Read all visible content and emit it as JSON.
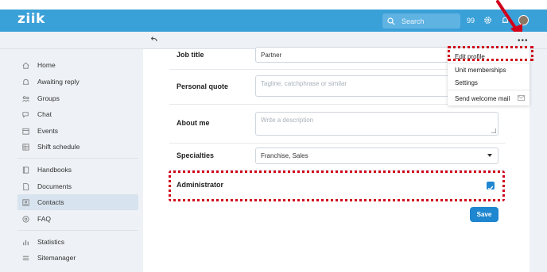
{
  "app": {
    "logo": "ziik"
  },
  "header": {
    "search_placeholder": "Search",
    "count": "99",
    "icons": [
      "search-icon",
      "gear-icon",
      "bell-icon",
      "avatar"
    ]
  },
  "sidebar": {
    "items": [
      {
        "label": "Home",
        "icon": "home-icon"
      },
      {
        "label": "Awaiting reply",
        "icon": "bell-icon"
      },
      {
        "label": "Groups",
        "icon": "groups-icon"
      },
      {
        "label": "Chat",
        "icon": "chat-icon"
      },
      {
        "label": "Events",
        "icon": "calendar-icon"
      },
      {
        "label": "Shift schedule",
        "icon": "schedule-icon"
      },
      {
        "label": "Handbooks",
        "icon": "book-icon"
      },
      {
        "label": "Documents",
        "icon": "document-icon"
      },
      {
        "label": "Contacts",
        "icon": "contacts-icon",
        "active": true
      },
      {
        "label": "FAQ",
        "icon": "faq-icon"
      },
      {
        "label": "Statistics",
        "icon": "statistics-icon"
      },
      {
        "label": "Sitemanager",
        "icon": "sitemanager-icon"
      }
    ]
  },
  "form": {
    "job_title": {
      "label": "Job title",
      "value": "Partner"
    },
    "personal_quote": {
      "label": "Personal quote",
      "placeholder": "Tagline, catchphrase or similar"
    },
    "about_me": {
      "label": "About me",
      "placeholder": "Write a description"
    },
    "specialties": {
      "label": "Specialties",
      "value": "Franchise, Sales"
    },
    "administrator": {
      "label": "Administrator",
      "checked": true
    },
    "save_label": "Save"
  },
  "menu": {
    "items": [
      "Edit profile",
      "Unit memberships",
      "Settings",
      "Send welcome mail"
    ]
  },
  "colors": {
    "header_blue": "#3aa0d8",
    "primary_blue": "#1f86d0",
    "annotation_red": "#d0021b"
  }
}
